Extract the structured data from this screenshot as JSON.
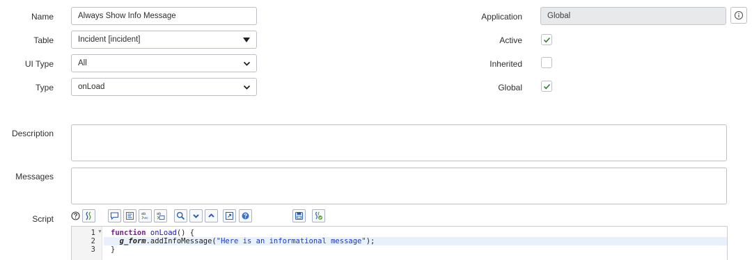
{
  "form": {
    "name": {
      "label": "Name",
      "value": "Always Show Info Message"
    },
    "table": {
      "label": "Table",
      "value": "Incident [incident]"
    },
    "ui_type": {
      "label": "UI Type",
      "value": "All"
    },
    "type": {
      "label": "Type",
      "value": "onLoad"
    },
    "description": {
      "label": "Description",
      "value": ""
    },
    "messages": {
      "label": "Messages",
      "value": ""
    },
    "script": {
      "label": "Script"
    }
  },
  "right": {
    "application": {
      "label": "Application",
      "value": "Global"
    },
    "active": {
      "label": "Active",
      "checked": true
    },
    "inherited": {
      "label": "Inherited",
      "checked": false
    },
    "global": {
      "label": "Global",
      "checked": true
    }
  },
  "toolbar": {
    "tools": [
      "help-icon",
      "toggle-syntax-icon",
      "comment-icon",
      "format-icon",
      "replace-icon",
      "replace-all-icon",
      "search-icon",
      "next-icon",
      "previous-icon",
      "fullscreen-icon",
      "script-debugger-icon",
      "save-icon",
      "script-validator-icon"
    ]
  },
  "code": {
    "line_numbers": [
      "1",
      "2",
      "3"
    ],
    "line1": {
      "kw": "function",
      "name": "onLoad",
      "rest": "() {"
    },
    "line2": {
      "indent": "  ",
      "obj": "g_form",
      "call": ".addInfoMessage(",
      "str": "\"Here is an informational message\"",
      "end": ");"
    },
    "line3": {
      "text": "}"
    }
  },
  "colors": {
    "checkmark": "#2f7d33",
    "toolbar_icon": "#2f5fa8",
    "readonly_bg": "#e8e9ea"
  }
}
